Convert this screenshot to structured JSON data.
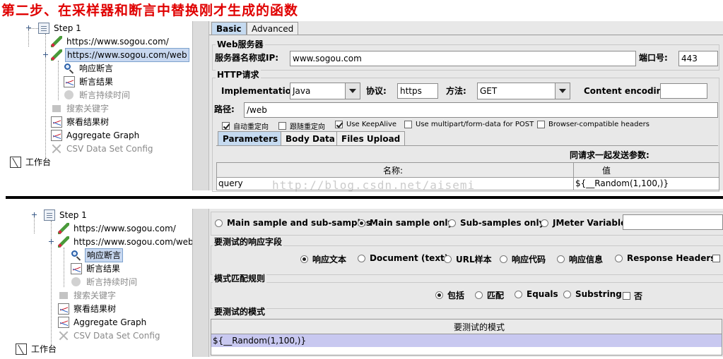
{
  "heading": "第二步、在采样器和断言中替换刚才生成的函数",
  "tree_top": {
    "step": "Step 1",
    "items": [
      {
        "label": "https://www.sogou.com/",
        "icon": "sampler-icon"
      },
      {
        "label": "https://www.sogou.com/web",
        "icon": "sampler-icon"
      },
      {
        "label": "响应断言",
        "icon": "assertion-magnifier-icon"
      },
      {
        "label": "断言结果",
        "icon": "results-graph-icon"
      },
      {
        "label": "断言持续时间",
        "icon": "duration-assertion-icon"
      },
      {
        "label": "搜索关键字",
        "icon": "keyword-icon"
      },
      {
        "label": "察看结果树",
        "icon": "results-tree-icon"
      },
      {
        "label": "Aggregate Graph",
        "icon": "aggregate-graph-icon"
      },
      {
        "label": "CSV Data Set Config",
        "icon": "csv-config-icon"
      }
    ],
    "workbench": "工作台"
  },
  "tree_bottom": {
    "step": "Step 1",
    "items": [
      {
        "label": "https://www.sogou.com/"
      },
      {
        "label": "https://www.sogou.com/web"
      },
      {
        "label": "响应断言"
      },
      {
        "label": "断言结果"
      },
      {
        "label": "断言持续时间"
      },
      {
        "label": "搜索关键字"
      },
      {
        "label": "察看结果树"
      },
      {
        "label": "Aggregate Graph"
      },
      {
        "label": "CSV Data Set Config"
      }
    ],
    "workbench": "工作台"
  },
  "sampler": {
    "tabs": [
      "Basic",
      "Advanced"
    ],
    "web_server_title": "Web服务器",
    "server_label": "服务器名称或IP:",
    "server_value": "www.sogou.com",
    "port_label": "端口号:",
    "port_value": "443",
    "http_title": "HTTP请求",
    "impl_label": "Implementation:",
    "impl_value": "Java",
    "protocol_label": "协议:",
    "protocol_value": "https",
    "method_label": "方法:",
    "method_value": "GET",
    "encoding_label": "Content encoding:",
    "encoding_value": "",
    "path_label": "路径:",
    "path_value": "/web",
    "checkboxes": [
      {
        "label": "自动重定向",
        "checked": true
      },
      {
        "label": "跟随重定向",
        "checked": false
      },
      {
        "label": "Use KeepAlive",
        "checked": true
      },
      {
        "label": "Use multipart/form-data for POST",
        "checked": false
      },
      {
        "label": "Browser-compatible headers",
        "checked": false
      }
    ],
    "param_tabs": [
      "Parameters",
      "Body Data",
      "Files Upload"
    ],
    "params_caption": "同请求一起发送参数:",
    "col_name": "名称:",
    "col_value": "值",
    "row_name": "query",
    "row_value": "${__Random(1,100,)}"
  },
  "watermark": "http://blog.csdn.net/aisemi",
  "assertion": {
    "apply_options": [
      "Main sample and sub-samples",
      "Main sample only",
      "Sub-samples only",
      "JMeter Variable"
    ],
    "apply_selected": 1,
    "field_title": "要测试的响应字段",
    "field_options": [
      "响应文本",
      "Document (text)",
      "URL样本",
      "响应代码",
      "响应信息",
      "Response Headers"
    ],
    "field_selected": 0,
    "rule_title": "模式匹配规则",
    "rule_options": [
      "包括",
      "匹配",
      "Equals",
      "Substring"
    ],
    "rule_selected": 0,
    "not_label": "否",
    "patterns_title": "要测试的模式",
    "patterns_header": "要测试的模式",
    "pattern_value": "${__Random(1,100,)}"
  }
}
